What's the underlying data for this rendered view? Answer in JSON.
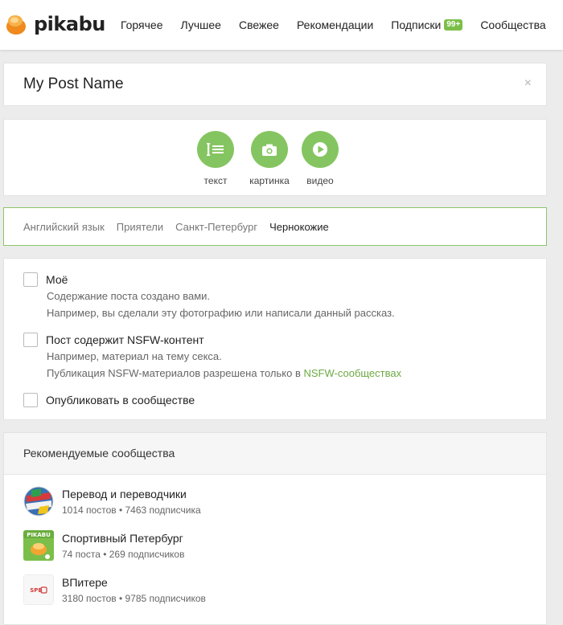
{
  "header": {
    "logo_text": "pikabu",
    "nav": [
      {
        "label": "Горячее"
      },
      {
        "label": "Лучшее"
      },
      {
        "label": "Свежее"
      },
      {
        "label": "Рекомендации"
      },
      {
        "label": "Подписки",
        "badge": "99+"
      },
      {
        "label": "Сообщества"
      }
    ]
  },
  "post": {
    "title": "My Post Name",
    "close_icon": "×"
  },
  "content_types": [
    {
      "label": "текст",
      "icon": "text-icon"
    },
    {
      "label": "картинка",
      "icon": "camera-icon"
    },
    {
      "label": "видео",
      "icon": "play-icon"
    }
  ],
  "tags": [
    "Английский язык",
    "Приятели",
    "Санкт-Петербург",
    "Чернокожие"
  ],
  "options": {
    "mine": {
      "label": "Моё",
      "desc1": "Содержание поста создано вами.",
      "desc2": "Например, вы сделали эту фотографию или написали данный рассказ."
    },
    "nsfw": {
      "label": "Пост содержит NSFW-контент",
      "desc1": "Например, материал на тему секса.",
      "desc2_prefix": "Публикация NSFW-материалов разрешена только в ",
      "desc2_link": "NSFW-сообществах"
    },
    "community": {
      "label": "Опубликовать в сообществе"
    }
  },
  "communities": {
    "title": "Рекомендуемые сообщества",
    "items": [
      {
        "name": "Перевод и переводчики",
        "stats": "1014 постов • 7463 подписчика"
      },
      {
        "name": "Спортивный Петербург",
        "stats": "74 поста • 269 подписчиков"
      },
      {
        "name": "ВПитере",
        "stats": "3180 постов • 9785 подписчиков"
      }
    ]
  },
  "colors": {
    "accent_green": "#85c561",
    "link_green": "#6da944",
    "badge_green": "#7bbf4a"
  }
}
